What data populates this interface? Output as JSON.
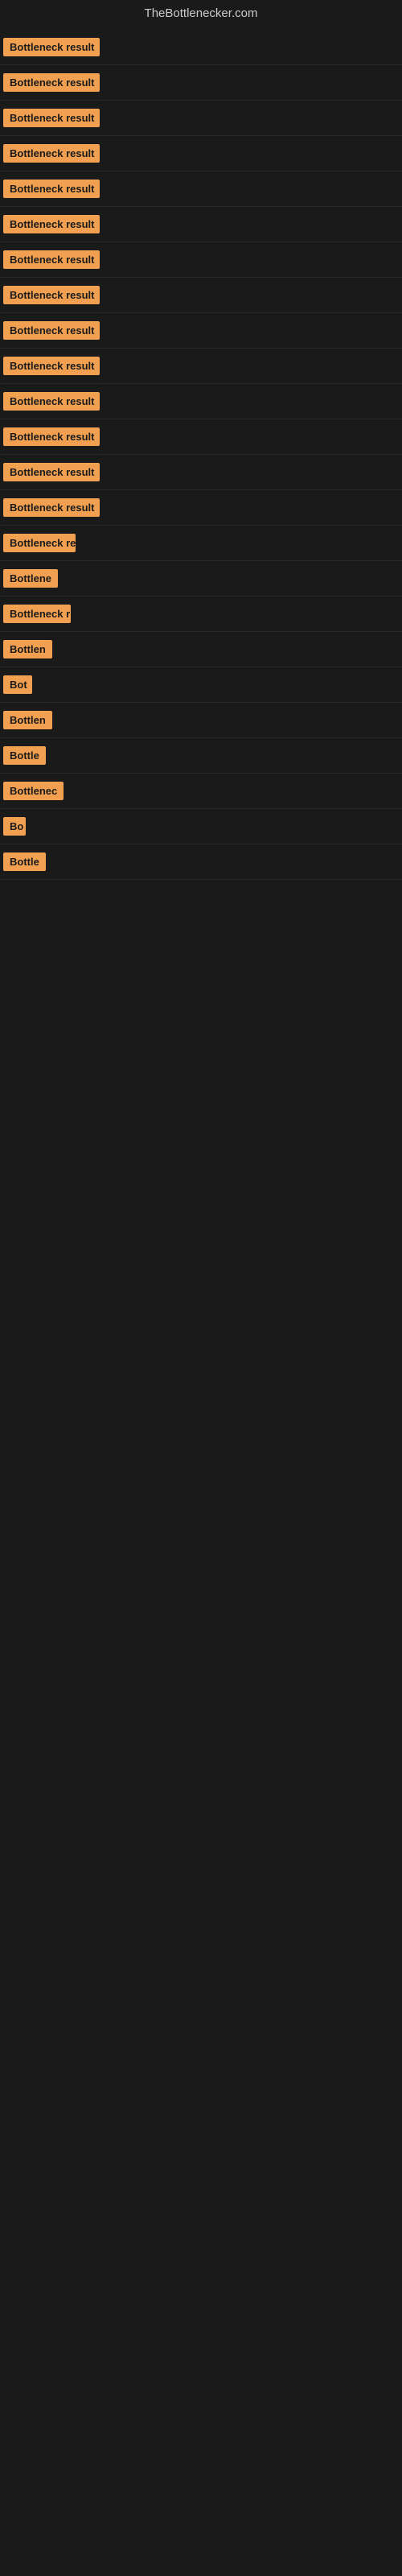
{
  "header": {
    "title": "TheBottlenecker.com"
  },
  "rows": [
    {
      "label": "Bottleneck result",
      "width": 120
    },
    {
      "label": "Bottleneck result",
      "width": 120
    },
    {
      "label": "Bottleneck result",
      "width": 120
    },
    {
      "label": "Bottleneck result",
      "width": 120
    },
    {
      "label": "Bottleneck result",
      "width": 120
    },
    {
      "label": "Bottleneck result",
      "width": 120
    },
    {
      "label": "Bottleneck result",
      "width": 120
    },
    {
      "label": "Bottleneck result",
      "width": 120
    },
    {
      "label": "Bottleneck result",
      "width": 120
    },
    {
      "label": "Bottleneck result",
      "width": 120
    },
    {
      "label": "Bottleneck result",
      "width": 120
    },
    {
      "label": "Bottleneck result",
      "width": 120
    },
    {
      "label": "Bottleneck result",
      "width": 120
    },
    {
      "label": "Bottleneck result",
      "width": 120
    },
    {
      "label": "Bottleneck re",
      "width": 90
    },
    {
      "label": "Bottlene",
      "width": 72
    },
    {
      "label": "Bottleneck r",
      "width": 84
    },
    {
      "label": "Bottlen",
      "width": 64
    },
    {
      "label": "Bot",
      "width": 36
    },
    {
      "label": "Bottlen",
      "width": 64
    },
    {
      "label": "Bottle",
      "width": 54
    },
    {
      "label": "Bottlenec",
      "width": 78
    },
    {
      "label": "Bo",
      "width": 28
    },
    {
      "label": "Bottle",
      "width": 54
    }
  ],
  "accent_color": "#f0a050"
}
